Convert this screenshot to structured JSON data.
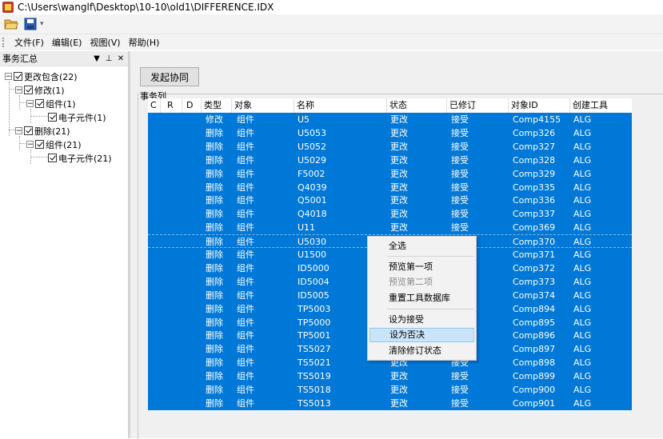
{
  "window": {
    "title": "C:\\Users\\wanglf\\Desktop\\10-10\\old1\\DIFFERENCE.IDX"
  },
  "menubar": {
    "items": [
      "文件(F)",
      "编辑(E)",
      "视图(V)",
      "帮助(H)"
    ]
  },
  "left_panel": {
    "title": "事务汇总",
    "tree": [
      {
        "label": "更改包含(22)"
      },
      {
        "label": "修改(1)"
      },
      {
        "label": "组件(1)"
      },
      {
        "label": "电子元件(1)"
      },
      {
        "label": "删除(21)"
      },
      {
        "label": "组件(21)"
      },
      {
        "label": "电子元件(21)"
      }
    ]
  },
  "main": {
    "launch_button": "发起协同",
    "group_label": "事务列",
    "columns": [
      "C",
      "R",
      "D",
      "类型",
      "对象",
      "名称",
      "状态",
      "已修订",
      "对象ID",
      "创建工具"
    ],
    "rows": [
      [
        "修改",
        "组件",
        "U5",
        "更改",
        "接受",
        "Comp4155",
        "ALG"
      ],
      [
        "删除",
        "组件",
        "U5053",
        "更改",
        "接受",
        "Comp326",
        "ALG"
      ],
      [
        "删除",
        "组件",
        "U5052",
        "更改",
        "接受",
        "Comp327",
        "ALG"
      ],
      [
        "删除",
        "组件",
        "U5029",
        "更改",
        "接受",
        "Comp328",
        "ALG"
      ],
      [
        "删除",
        "组件",
        "F5002",
        "更改",
        "接受",
        "Comp329",
        "ALG"
      ],
      [
        "删除",
        "组件",
        "Q4039",
        "更改",
        "接受",
        "Comp335",
        "ALG"
      ],
      [
        "删除",
        "组件",
        "Q5001",
        "更改",
        "接受",
        "Comp336",
        "ALG"
      ],
      [
        "删除",
        "组件",
        "Q4018",
        "更改",
        "接受",
        "Comp337",
        "ALG"
      ],
      [
        "删除",
        "组件",
        "U11",
        "更改",
        "接受",
        "Comp369",
        "ALG"
      ],
      [
        "删除",
        "组件",
        "U5030",
        "",
        "",
        "Comp370",
        "ALG"
      ],
      [
        "删除",
        "组件",
        "U1500",
        "",
        "",
        "Comp371",
        "ALG"
      ],
      [
        "删除",
        "组件",
        "ID5000",
        "",
        "",
        "Comp372",
        "ALG"
      ],
      [
        "删除",
        "组件",
        "ID5004",
        "",
        "",
        "Comp373",
        "ALG"
      ],
      [
        "删除",
        "组件",
        "ID5005",
        "",
        "",
        "Comp374",
        "ALG"
      ],
      [
        "删除",
        "组件",
        "TP5003",
        "",
        "",
        "Comp894",
        "ALG"
      ],
      [
        "删除",
        "组件",
        "TP5000",
        "",
        "",
        "Comp895",
        "ALG"
      ],
      [
        "删除",
        "组件",
        "TP5001",
        "",
        "",
        "Comp896",
        "ALG"
      ],
      [
        "删除",
        "组件",
        "TS5027",
        "",
        "",
        "Comp897",
        "ALG"
      ],
      [
        "删除",
        "组件",
        "TS5021",
        "更改",
        "接受",
        "Comp898",
        "ALG"
      ],
      [
        "删除",
        "组件",
        "TS5019",
        "更改",
        "接受",
        "Comp899",
        "ALG"
      ],
      [
        "删除",
        "组件",
        "TS5018",
        "更改",
        "接受",
        "Comp900",
        "ALG"
      ],
      [
        "删除",
        "组件",
        "TS5013",
        "更改",
        "接受",
        "Comp901",
        "ALG"
      ]
    ]
  },
  "context_menu": {
    "items": [
      "全选",
      "预览第一项",
      "预览第二项",
      "重置工具数据库",
      "设为接受",
      "设为否决",
      "清除修订状态"
    ]
  },
  "colors": {
    "selection": "#0078d7",
    "menu_hover": "#cce4f7"
  }
}
